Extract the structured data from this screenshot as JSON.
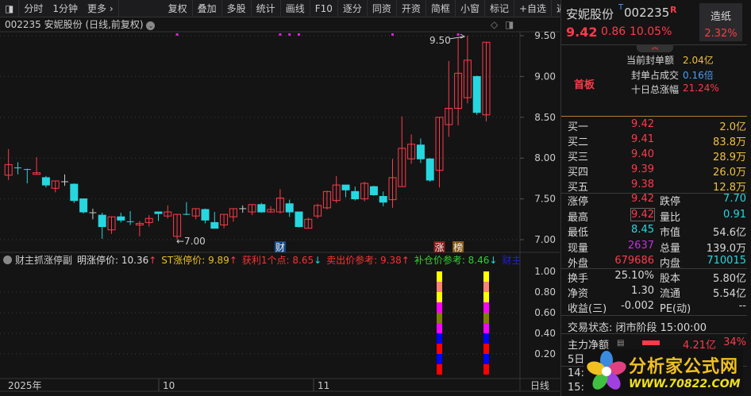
{
  "toolbar": {
    "items": [
      "分时",
      "1分钟",
      "更多 ›",
      "复权",
      "叠加",
      "多股",
      "统计",
      "画线",
      "F10",
      "逐分",
      "同资",
      "开资",
      "简框",
      "小窗",
      "标记",
      "+自选",
      "返回"
    ]
  },
  "title": "002235 安妮股份 (日线,前复权)",
  "price_axis": [
    "9.50",
    "9.00",
    "8.50",
    "8.00",
    "7.50",
    "7.00"
  ],
  "annotations": {
    "high": "9.50",
    "low": "7.00"
  },
  "markers": [
    {
      "label": "财",
      "color": "#1a4e8a",
      "index": 29
    },
    {
      "label": "涨",
      "color": "#8a1a1a",
      "index": 46
    },
    {
      "label": "榜",
      "color": "#8a5a1a",
      "index": 48
    }
  ],
  "indicator": {
    "name": "财主抓涨停副",
    "items": [
      {
        "text": "明涨停价: 10.36",
        "color": "#dddddd",
        "arrow": "↑",
        "arrow_color": "#ff3a4a"
      },
      {
        "text": "ST涨停价: 9.89",
        "color": "#e8c020",
        "arrow": "↑",
        "arrow_color": "#ff3a4a"
      },
      {
        "text": "获利1个点: 8.65",
        "color": "#ff3030",
        "arrow": "↓",
        "arrow_color": "#26d7e0"
      },
      {
        "text": "卖出价参考: 9.38",
        "color": "#ff3030",
        "arrow": "↑",
        "arrow_color": "#ff3a4a"
      },
      {
        "text": "补仓价参考: 8.46",
        "color": "#30d030",
        "arrow": "↓",
        "arrow_color": "#26d7e0"
      },
      {
        "text": "财主抓涨",
        "color": "#2020e0",
        "arrow": "",
        "arrow_color": ""
      }
    ],
    "axis": [
      "1.00",
      "0.80",
      "0.60",
      "0.40",
      "0.20"
    ]
  },
  "x_axis": [
    "2025年",
    "10",
    "11"
  ],
  "period": "日线",
  "chart_data": {
    "type": "candlestick",
    "ohlc": [
      [
        7.79,
        8.11,
        7.73,
        7.92
      ],
      [
        7.88,
        7.95,
        7.8,
        7.87
      ],
      [
        7.86,
        7.87,
        7.69,
        7.85
      ],
      [
        7.8,
        8.01,
        7.8,
        7.82
      ],
      [
        7.76,
        7.78,
        7.64,
        7.67
      ],
      [
        7.63,
        7.72,
        7.58,
        7.72
      ],
      [
        7.71,
        7.8,
        7.66,
        7.71
      ],
      [
        7.68,
        7.69,
        7.45,
        7.48
      ],
      [
        7.5,
        7.5,
        7.32,
        7.34
      ],
      [
        7.33,
        7.38,
        7.25,
        7.33
      ],
      [
        7.3,
        7.33,
        7.01,
        7.16
      ],
      [
        7.12,
        7.28,
        7.07,
        7.28
      ],
      [
        7.28,
        7.33,
        7.21,
        7.24
      ],
      [
        7.22,
        7.35,
        7.18,
        7.21
      ],
      [
        7.18,
        7.23,
        7.04,
        7.2
      ],
      [
        7.21,
        7.3,
        7.16,
        7.26
      ],
      [
        7.34,
        7.34,
        7.23,
        7.32
      ],
      [
        7.29,
        7.42,
        7.26,
        7.34
      ],
      [
        7.04,
        7.31,
        7.0,
        7.31
      ],
      [
        7.31,
        7.46,
        7.3,
        7.3
      ],
      [
        7.29,
        7.38,
        7.25,
        7.38
      ],
      [
        7.37,
        7.38,
        7.2,
        7.24
      ],
      [
        7.21,
        7.34,
        7.14,
        7.14
      ],
      [
        7.18,
        7.31,
        7.14,
        7.31
      ],
      [
        7.28,
        7.38,
        7.22,
        7.38
      ],
      [
        7.38,
        7.42,
        7.33,
        7.38
      ],
      [
        7.34,
        7.43,
        7.3,
        7.43
      ],
      [
        7.43,
        7.45,
        7.33,
        7.34
      ],
      [
        7.34,
        7.41,
        7.33,
        7.37
      ],
      [
        7.34,
        7.62,
        7.32,
        7.51
      ],
      [
        7.44,
        7.49,
        7.28,
        7.34
      ],
      [
        7.34,
        7.34,
        7.15,
        7.16
      ],
      [
        7.14,
        7.27,
        7.14,
        7.25
      ],
      [
        7.29,
        7.44,
        7.26,
        7.42
      ],
      [
        7.39,
        7.6,
        7.37,
        7.59
      ],
      [
        7.48,
        7.78,
        7.45,
        7.67
      ],
      [
        7.67,
        7.67,
        7.52,
        7.61
      ],
      [
        7.59,
        7.65,
        7.48,
        7.5
      ],
      [
        7.5,
        7.71,
        7.47,
        7.69
      ],
      [
        7.65,
        7.66,
        7.54,
        7.55
      ],
      [
        7.53,
        7.59,
        7.41,
        7.46
      ],
      [
        7.49,
        7.99,
        7.39,
        7.76
      ],
      [
        7.65,
        8.51,
        7.65,
        8.12
      ],
      [
        7.99,
        8.29,
        7.93,
        8.17
      ],
      [
        8.16,
        8.24,
        7.94,
        7.99
      ],
      [
        7.99,
        8.0,
        7.71,
        7.73
      ],
      [
        7.85,
        8.5,
        7.64,
        8.5
      ],
      [
        8.41,
        9.19,
        8.26,
        8.61
      ],
      [
        8.61,
        9.48,
        8.4,
        9.04
      ],
      [
        8.74,
        9.5,
        8.67,
        9.2
      ],
      [
        9.0,
        9.01,
        8.53,
        8.56
      ],
      [
        8.53,
        9.42,
        8.45,
        9.42
      ]
    ],
    "ylim": [
      6.8,
      9.6
    ],
    "signal_dots": [
      18,
      29,
      30,
      31,
      41,
      48
    ],
    "stack_bars": {
      "indices": [
        46,
        51
      ],
      "segments_top_to_bottom": [
        "#ffff00",
        "#ff8080",
        "#ffff00",
        "#ff00ff",
        "#808000",
        "#ff00ff",
        "#0000ff",
        "#ff0000",
        "#0000ff",
        "#ff0000"
      ],
      "total": 1.0
    },
    "colors": {
      "up": "#ff3a4a",
      "down": "#26d7e0",
      "flat": "#cccccc"
    }
  },
  "quote": {
    "name": "安妮股份",
    "code": "002235",
    "flag": "R",
    "price": "9.42",
    "change": "0.86",
    "pct": "10.05%",
    "sector": "造纸",
    "sector_pct": "2.32%",
    "board": "首板",
    "seal_label": "当前封单额",
    "seal": "2.04亿",
    "ratio_label": "封单占成交",
    "ratio": "0.16倍",
    "ten_label": "十日总涨幅",
    "ten": "21.24%",
    "bids": [
      {
        "l": "买一",
        "p": "9.42",
        "v": "2.0亿"
      },
      {
        "l": "买二",
        "p": "9.41",
        "v": "83.8万"
      },
      {
        "l": "买三",
        "p": "9.40",
        "v": "28.9万"
      },
      {
        "l": "买四",
        "p": "9.39",
        "v": "26.0万"
      },
      {
        "l": "买五",
        "p": "9.38",
        "v": "12.8万"
      }
    ],
    "stats": [
      [
        "涨停",
        "9.42",
        "red",
        "跌停",
        "7.70",
        "cy"
      ],
      [
        "最高",
        "9.42",
        "red",
        "量比",
        "0.91",
        "cy"
      ],
      [
        "最低",
        "8.45",
        "cy",
        "市值",
        "54.6亿",
        "wh"
      ],
      [
        "现量",
        "2637",
        "pu",
        "总量",
        "139.0万",
        "wh"
      ],
      [
        "外盘",
        "679686",
        "red",
        "内盘",
        "710015",
        "cy"
      ]
    ],
    "stats2": [
      [
        "换手",
        "25.10%",
        "股本",
        "5.80亿"
      ],
      [
        "净资",
        "1.30",
        "流通",
        "5.54亿"
      ],
      [
        "收益(三)",
        "-0.002",
        "PE(动)",
        "--"
      ]
    ],
    "status": "交易状态: 闭市阶段 15:00:00",
    "main_label": "主力净额",
    "main_val": "4.21亿",
    "main_pct": "34%",
    "five_day": "5日",
    "t1": "14:5",
    "t2": "15:0"
  },
  "watermark": {
    "cn": "分析家公式网",
    "url": "WWW.70822.COM"
  }
}
